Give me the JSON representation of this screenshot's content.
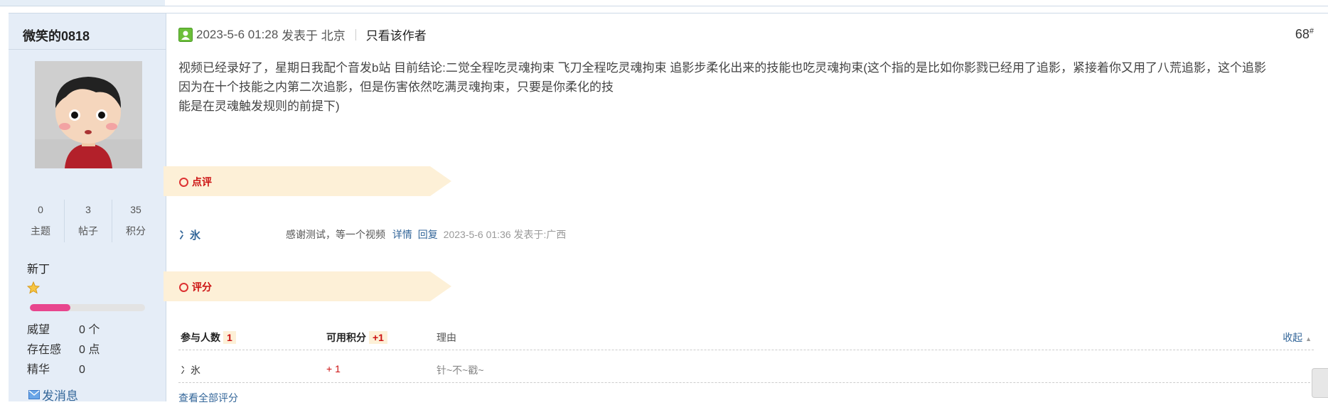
{
  "profile": {
    "username": "微笑的0818",
    "stats": [
      {
        "value": "0",
        "label": "主题"
      },
      {
        "value": "3",
        "label": "帖子"
      },
      {
        "value": "35",
        "label": "积分"
      }
    ],
    "rank": "新丁",
    "level_progress": 0.35,
    "fields": [
      {
        "key": "威望",
        "value": "0 个"
      },
      {
        "key": "存在感",
        "value": "0 点"
      },
      {
        "key": "精华",
        "value": "0"
      }
    ],
    "send_message": "发消息"
  },
  "post": {
    "datetime": "2023-5-6 01:28",
    "posted_at": "发表于 北京",
    "only_author": "只看该作者",
    "floor": "68",
    "floor_mark": "#",
    "lines": [
      "视频已经录好了，星期日我配个音发b站 目前结论:二觉全程吃灵魂拘束 飞刀全程吃灵魂拘束   追影步柔化出来的技能也吃灵魂拘束(这个指的是比如你影戮已经用了追影，紧接着你又用了八荒追影，这个追影",
      "因为在十个技能之内第二次追影，但是伤害依然吃满灵魂拘束，只要是你柔化的技",
      "能是在灵魂触发规则的前提下)"
    ]
  },
  "review": {
    "title": "点评",
    "user": "冫氷",
    "text": "感谢测试，等一个视频",
    "detail": "详情",
    "reply": "回复",
    "time": "2023-5-6 01:36 发表于:广西"
  },
  "rating": {
    "title": "评分",
    "headers": {
      "participants": "参与人数",
      "participants_count": "1",
      "points": "可用积分",
      "points_value": "+1",
      "reason": "理由",
      "collapse": "收起"
    },
    "rows": [
      {
        "user": "冫氷",
        "points": "+ 1",
        "reason": "针~不~戳~"
      }
    ],
    "view_all": "查看全部评分"
  },
  "colors": {
    "link": "#336699",
    "accent_red": "#cc1111",
    "sidebar_bg": "#e5edf7",
    "banner_bg": "#fdf0d7",
    "progress": "#e8468e"
  }
}
